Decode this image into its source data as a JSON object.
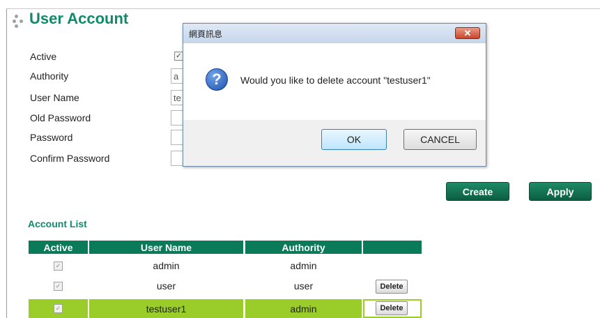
{
  "page": {
    "title": "User Account"
  },
  "form": {
    "active_label": "Active",
    "active_checked": "✓",
    "authority_label": "Authority",
    "authority_value": "a",
    "username_label": "User Name",
    "username_value": "te",
    "old_password_label": "Old Password",
    "password_label": "Password",
    "confirm_password_label": "Confirm Password"
  },
  "actions": {
    "create_label": "Create",
    "apply_label": "Apply"
  },
  "account_list": {
    "title": "Account List",
    "columns": [
      "Active",
      "User Name",
      "Authority",
      ""
    ],
    "rows": [
      {
        "active": "✓",
        "username": "admin",
        "authority": "admin",
        "action": ""
      },
      {
        "active": "✓",
        "username": "user",
        "authority": "user",
        "action": "Delete"
      },
      {
        "active": "✓",
        "username": "testuser1",
        "authority": "admin",
        "action": "Delete"
      }
    ],
    "highlight_color": "#9acd2a"
  },
  "dialog": {
    "title": "網頁訊息",
    "close_glyph": "✕",
    "icon_glyph": "?",
    "message": "Would you like to delete account \"testuser1\"",
    "ok_label": "OK",
    "cancel_label": "CANCEL"
  },
  "colors": {
    "accent": "#0f8a6c",
    "header_bg": "#0b7a58",
    "button_bg": "#0b5e42"
  }
}
